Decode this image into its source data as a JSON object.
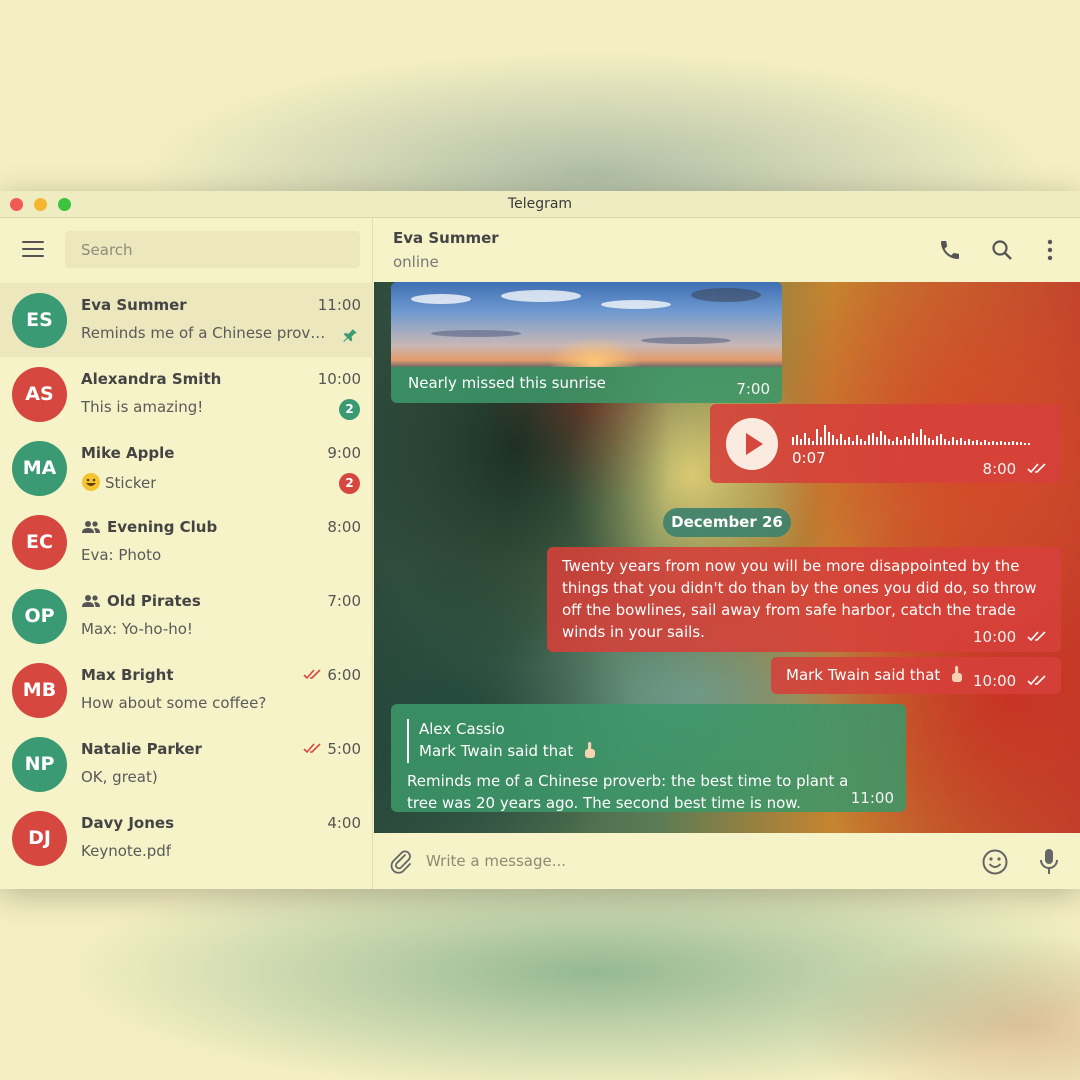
{
  "window": {
    "title": "Telegram"
  },
  "search": {
    "placeholder": "Search"
  },
  "chats": [
    {
      "initials": "ES",
      "name": "Eva Summer",
      "time": "11:00",
      "preview": "Reminds me of a Chinese prover...",
      "color": "#3a9a73",
      "pinned": true
    },
    {
      "initials": "AS",
      "name": "Alexandra Smith",
      "time": "10:00",
      "preview": "This is amazing!",
      "color": "#d64740",
      "badge": "2",
      "badge_color": "#3a9a73"
    },
    {
      "initials": "MA",
      "name": "Mike Apple",
      "time": "9:00",
      "preview": "Sticker",
      "color": "#3a9a73",
      "badge": "2",
      "badge_color": "#d64740"
    },
    {
      "initials": "EC",
      "name": "Evening Club",
      "time": "8:00",
      "preview": "Eva: Photo",
      "color": "#d64740",
      "group": true
    },
    {
      "initials": "OP",
      "name": "Old Pirates",
      "time": "7:00",
      "preview": "Max: Yo-ho-ho!",
      "color": "#3a9a73",
      "group": true
    },
    {
      "initials": "MB",
      "name": "Max Bright",
      "time": "6:00",
      "preview": "How about some coffee?",
      "color": "#d64740",
      "read": true
    },
    {
      "initials": "NP",
      "name": "Natalie Parker",
      "time": "5:00",
      "preview": "OK, great)",
      "color": "#3a9a73",
      "read": true
    },
    {
      "initials": "DJ",
      "name": "Davy Jones",
      "time": "4:00",
      "preview": "Keynote.pdf",
      "color": "#d64740"
    }
  ],
  "header": {
    "name": "Eva Summer",
    "status": "online"
  },
  "messages": {
    "photo": {
      "caption": "Nearly missed this sunrise",
      "time": "7:00"
    },
    "voice": {
      "duration": "0:07",
      "time": "8:00"
    },
    "date": "December 26",
    "quote": {
      "text": "Twenty years from now you will be more disappointed by the things that you didn't do than by the ones you did do, so throw off the bowlines, sail away from safe harbor, catch the trade winds in your sails.",
      "time": "10:00"
    },
    "twain": {
      "text": "Mark Twain said that",
      "time": "10:00"
    },
    "reply": {
      "author": "Alex Cassio",
      "quoted": "Mark Twain said that",
      "text": "Reminds me of a Chinese proverb: the best time to plant a tree was 20 years ago. The second best time is now.",
      "time": "11:00"
    }
  },
  "composer": {
    "placeholder": "Write a message..."
  },
  "colors": {
    "green": "#3a9a73",
    "red": "#d64740",
    "bg": "#f7f3c8"
  }
}
